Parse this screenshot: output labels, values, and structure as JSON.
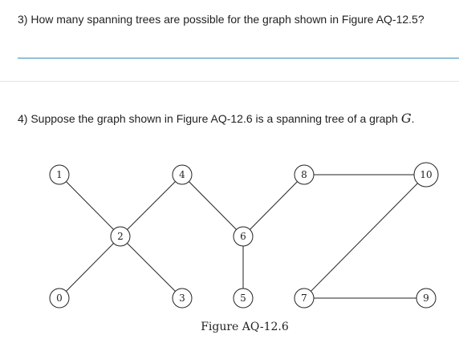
{
  "question3": {
    "text": "3) How many spanning trees are possible for the graph shown in Figure AQ-12.5?",
    "answer_value": ""
  },
  "question4": {
    "text_before": "4) Suppose the graph shown in Figure AQ-12.6 is a spanning tree of a graph ",
    "math_variable": "G",
    "text_after": "."
  },
  "figure": {
    "caption": "Figure AQ-12.6",
    "nodes": [
      "0",
      "1",
      "2",
      "3",
      "4",
      "5",
      "6",
      "7",
      "8",
      "9",
      "10"
    ],
    "edges": [
      [
        "1",
        "2"
      ],
      [
        "0",
        "2"
      ],
      [
        "2",
        "4"
      ],
      [
        "2",
        "3"
      ],
      [
        "4",
        "6"
      ],
      [
        "6",
        "8"
      ],
      [
        "6",
        "5"
      ],
      [
        "8",
        "10"
      ],
      [
        "10",
        "7"
      ],
      [
        "7",
        "9"
      ]
    ]
  }
}
